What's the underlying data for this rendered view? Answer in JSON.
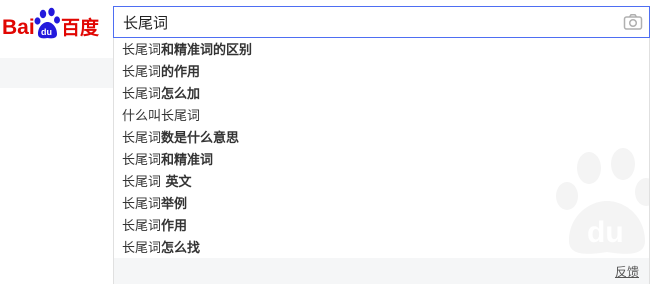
{
  "logo": {
    "brand_text": "Baidu百度",
    "paw_text": "du"
  },
  "search": {
    "value": "长尾词",
    "camera_icon": "camera-icon"
  },
  "suggestions": [
    {
      "prefix": "长尾词",
      "rest": "和精准词的区别"
    },
    {
      "prefix": "长尾词",
      "rest": "的作用"
    },
    {
      "prefix": "长尾词",
      "rest": "怎么加"
    },
    {
      "prefix": "什么叫长尾词",
      "rest": ""
    },
    {
      "prefix": "长尾词",
      "rest": "数是什么意思"
    },
    {
      "prefix": "长尾词",
      "rest": "和精准词"
    },
    {
      "prefix": "长尾词",
      "rest": " 英文"
    },
    {
      "prefix": "长尾词",
      "rest": "举例"
    },
    {
      "prefix": "长尾词",
      "rest": "作用"
    },
    {
      "prefix": "长尾词",
      "rest": "怎么找"
    }
  ],
  "footer": {
    "feedback_label": "反馈"
  },
  "colors": {
    "brand_red": "#e10602",
    "brand_blue": "#2319dc",
    "focus_border": "#4e6ef2"
  }
}
